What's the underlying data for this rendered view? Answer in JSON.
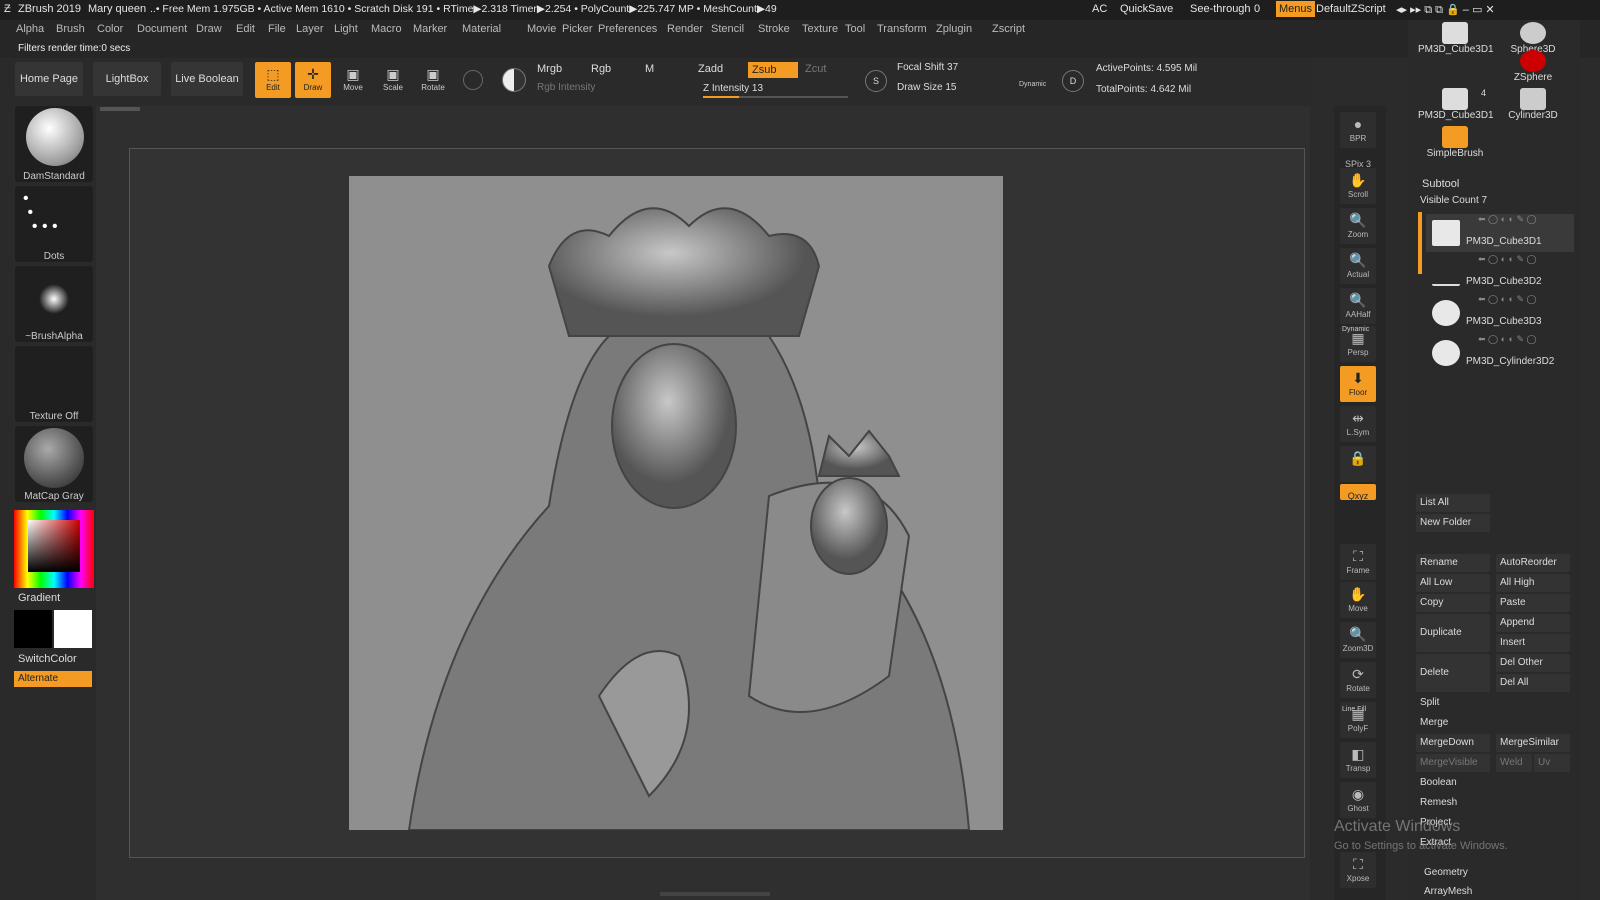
{
  "titlebar": {
    "app": "ZBrush 2019",
    "doc": "Mary queen",
    "stats": "..• Free Mem 1.975GB • Active Mem 1610 • Scratch Disk 191 • RTime▶2.318 Timer▶2.254 • PolyCount▶225.747 MP • MeshCount▶49",
    "ac": "AC",
    "quicksave": "QuickSave",
    "seethrough": "See-through",
    "seethrough_val": "0",
    "menus": "Menus",
    "script": "DefaultZScript"
  },
  "menubar": [
    "Alpha",
    "Brush",
    "Color",
    "Document",
    "Draw",
    "Edit",
    "File",
    "Layer",
    "Light",
    "Macro",
    "Marker",
    "Material",
    "Movie",
    "Picker",
    "Preferences",
    "Render",
    "Stencil",
    "Stroke",
    "Texture",
    "Tool",
    "Transform",
    "Zplugin",
    "Zscript"
  ],
  "status": "Filters render time:0 secs",
  "shelf": {
    "home": "Home Page",
    "lightbox": "LightBox",
    "liveboolean": "Live Boolean",
    "edit": "Edit",
    "draw": "Draw",
    "move": "Move",
    "scale": "Scale",
    "rotate": "Rotate",
    "mrgb": "Mrgb",
    "rgb": "Rgb",
    "m": "M",
    "zadd": "Zadd",
    "zsub": "Zsub",
    "zcut": "Zcut",
    "rgb_intensity": "Rgb Intensity",
    "z_intensity": "Z Intensity 13",
    "focal": "Focal Shift 37",
    "drawsize": "Draw Size 15",
    "dynamic": "Dynamic",
    "active": "ActivePoints: 4.595 Mil",
    "total": "TotalPoints: 4.642 Mil"
  },
  "left": {
    "brush": "DamStandard",
    "stroke": "Dots",
    "alpha": "~BrushAlpha",
    "texture": "Texture Off",
    "material": "MatCap Gray",
    "gradient": "Gradient",
    "switch": "SwitchColor",
    "alternate": "Alternate"
  },
  "righttools": [
    {
      "g": "●",
      "l": "BPR"
    },
    {
      "g": "SPix 3",
      "l": ""
    },
    {
      "g": "✋",
      "l": "Scroll"
    },
    {
      "g": "🔍",
      "l": "Zoom"
    },
    {
      "g": "🔍",
      "l": "Actual"
    },
    {
      "g": "🔍",
      "l": "AAHalf"
    },
    {
      "g": "▦",
      "l": "Persp"
    },
    {
      "g": "⬇",
      "l": "Floor"
    },
    {
      "g": "⇹",
      "l": "L.Sym"
    },
    {
      "g": "🔒",
      "l": ""
    },
    {
      "g": "Qxyz",
      "l": ""
    },
    {
      "g": "⛶",
      "l": "Frame"
    },
    {
      "g": "✋",
      "l": "Move"
    },
    {
      "g": "🔍",
      "l": "Zoom3D"
    },
    {
      "g": "⟳",
      "l": "Rotate"
    },
    {
      "g": "▦",
      "l": "PolyF"
    },
    {
      "g": "◧",
      "l": "Transp"
    },
    {
      "g": "◉",
      "l": "Ghost"
    },
    {
      "g": "⛶",
      "l": "Xpose"
    }
  ],
  "dynamic_label": "Dynamic",
  "linefill": "Line Fill",
  "toolpanel": {
    "items": [
      {
        "name": "PM3D_Cube3D1",
        "count": ""
      },
      {
        "name": "Sphere3D",
        "count": ""
      },
      {
        "name": "ZSphere",
        "count": ""
      },
      {
        "name": "PM3D_Cube3D1",
        "count": "4"
      },
      {
        "name": "Cylinder3D",
        "count": ""
      },
      {
        "name": "SimpleBrush",
        "count": ""
      }
    ],
    "subtool": "Subtool",
    "visible": "Visible Count 7",
    "subtools": [
      "PM3D_Cube3D1",
      "PM3D_Cube3D2",
      "PM3D_Cube3D3",
      "PM3D_Cylinder3D2"
    ],
    "buttons": {
      "listall": "List All",
      "newfolder": "New Folder",
      "rename": "Rename",
      "autoreorder": "AutoReorder",
      "alllow": "All Low",
      "allhigh": "All High",
      "copy": "Copy",
      "paste": "Paste",
      "duplicate": "Duplicate",
      "append": "Append",
      "insert": "Insert",
      "delete": "Delete",
      "delother": "Del Other",
      "delall": "Del All",
      "split": "Split",
      "merge": "Merge",
      "mergedown": "MergeDown",
      "mergesimilar": "MergeSimilar",
      "mergevisible": "MergeVisible",
      "weld": "Weld",
      "uv": "Uv",
      "boolean": "Boolean",
      "remesh": "Remesh",
      "project": "Project",
      "extract": "Extract",
      "geometry": "Geometry",
      "arraymesh": "ArrayMesh"
    }
  },
  "watermark": {
    "line1": "Activate Windows",
    "line2": "Go to Settings to activate Windows."
  },
  "colors": {
    "accent": "#f49b23",
    "bg": "#2b2b2b"
  }
}
